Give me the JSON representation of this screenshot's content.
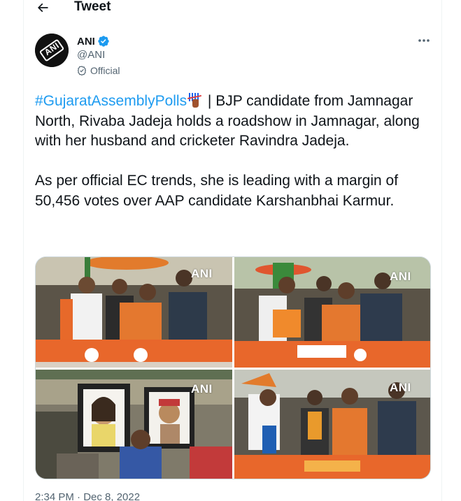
{
  "header": {
    "title": "Tweet",
    "back_icon": "arrow-left-icon"
  },
  "author": {
    "name": "ANI",
    "handle": "@ANI",
    "label": "Official",
    "avatar_text": "ANI",
    "verified_color": "#1d9bf0"
  },
  "tweet": {
    "hashtag": "#GujaratAssemblyPolls",
    "hashtag_emoji": "ballot-tally-emoji",
    "line1_rest": " | BJP candidate from Jamnagar North, Rivaba Jadeja holds a roadshow in Jamnagar, along with her husband and cricketer Ravindra Jadeja.",
    "paragraph2": "As per official EC trends, she is leading with a margin of 50,456 votes over AAP candidate Karshanbhai Karmur."
  },
  "media": {
    "watermark": "ANI",
    "photos": [
      {
        "name": "roadshow-photo-1"
      },
      {
        "name": "roadshow-photo-2"
      },
      {
        "name": "portraits-photo-3"
      },
      {
        "name": "roadshow-photo-4"
      }
    ]
  },
  "footer": {
    "timestamp": "2:34 PM · Dec 8, 2022"
  },
  "colors": {
    "accent": "#1d9bf0",
    "text": "#0f1419",
    "secondary": "#536471",
    "border": "#cfd9de"
  }
}
